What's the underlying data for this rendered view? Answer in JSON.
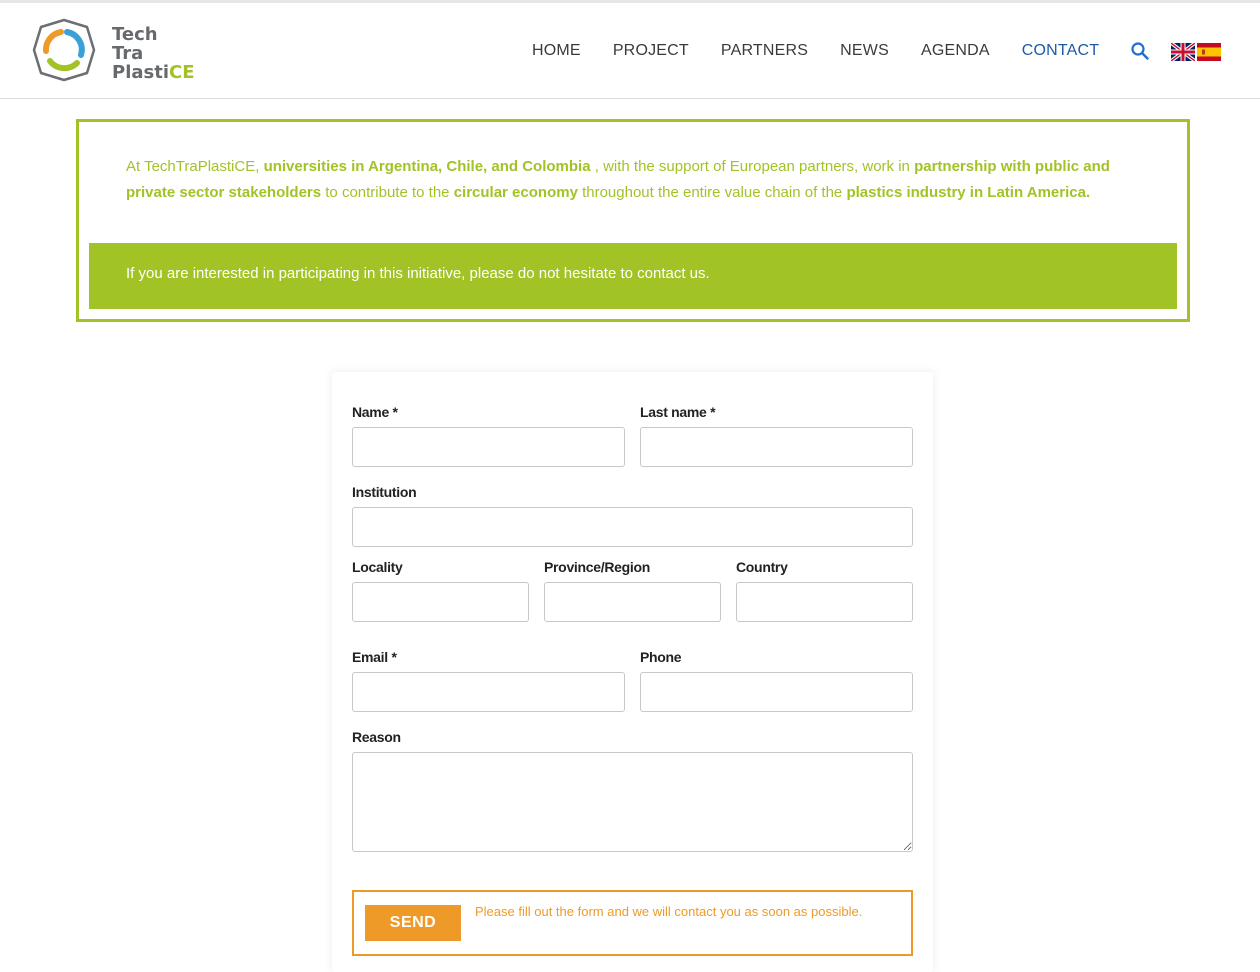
{
  "header": {
    "logo": {
      "line1": "Tech",
      "line2": "Tra",
      "line3_a": "Plasti",
      "line3_b": "CE"
    },
    "nav": [
      {
        "label": "HOME"
      },
      {
        "label": "PROJECT"
      },
      {
        "label": "PARTNERS"
      },
      {
        "label": "NEWS"
      },
      {
        "label": "AGENDA"
      },
      {
        "label": "CONTACT",
        "active": true
      }
    ],
    "icons": {
      "search": "search-icon",
      "flag_en": "uk-flag-icon",
      "flag_es": "spain-flag-icon"
    }
  },
  "intro": {
    "t1": "At TechTraPlastiCE, ",
    "b1": "universities in Argentina, Chile, and Colombia",
    "t2": " , with the support of European partners, work in ",
    "b2": "partnership with public and private sector stakeholders",
    "t3": " to contribute to the ",
    "b3": "circular economy",
    "t4": " throughout the entire value chain of the ",
    "b4": "plastics industry in Latin America.",
    "band": "If you are interested in participating in this initiative, please do not hesitate to contact us."
  },
  "form": {
    "name_label": "Name *",
    "lastname_label": "Last name *",
    "institution_label": "Institution",
    "locality_label": "Locality",
    "province_label": "Province/Region",
    "country_label": "Country",
    "email_label": "Email *",
    "phone_label": "Phone",
    "reason_label": "Reason",
    "send_label": "SEND",
    "send_note": "Please fill out the form and we will contact you as soon as possible."
  },
  "colors": {
    "accent_green": "#a2c326",
    "accent_orange": "#ee9a28",
    "nav_active": "#1f5aa6"
  }
}
